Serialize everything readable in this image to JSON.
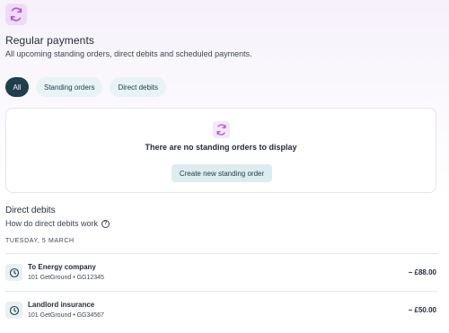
{
  "header": {
    "icon": "refresh-icon",
    "title": "Regular payments",
    "subtitle": "All upcoming standing orders, direct debits and scheduled payments."
  },
  "tabs": [
    {
      "label": "All",
      "active": true
    },
    {
      "label": "Standing orders",
      "active": false
    },
    {
      "label": "Direct debits",
      "active": false
    }
  ],
  "empty_state": {
    "icon": "refresh-icon",
    "message": "There are no standing orders to display",
    "button_label": "Create new standing order"
  },
  "direct_debits": {
    "title": "Direct debits",
    "help_link": "How do direct debits work",
    "help_icon": "question-circle-icon",
    "date_header": "TUESDAY, 5 MARCH",
    "items": [
      {
        "icon": "clock-icon",
        "name": "To  Energy company",
        "reference": "101 GetGround • GG12345",
        "amount": "− £88.00"
      },
      {
        "icon": "clock-icon",
        "name": "Landlord insurance",
        "reference": "101 GetGround • GG34567",
        "amount": "− £50.00"
      }
    ]
  },
  "colors": {
    "accent_purple": "#b455d6",
    "active_tab": "#1f3f4d",
    "tab_bg": "#e7f3f4",
    "button_bg": "#dcecef"
  }
}
